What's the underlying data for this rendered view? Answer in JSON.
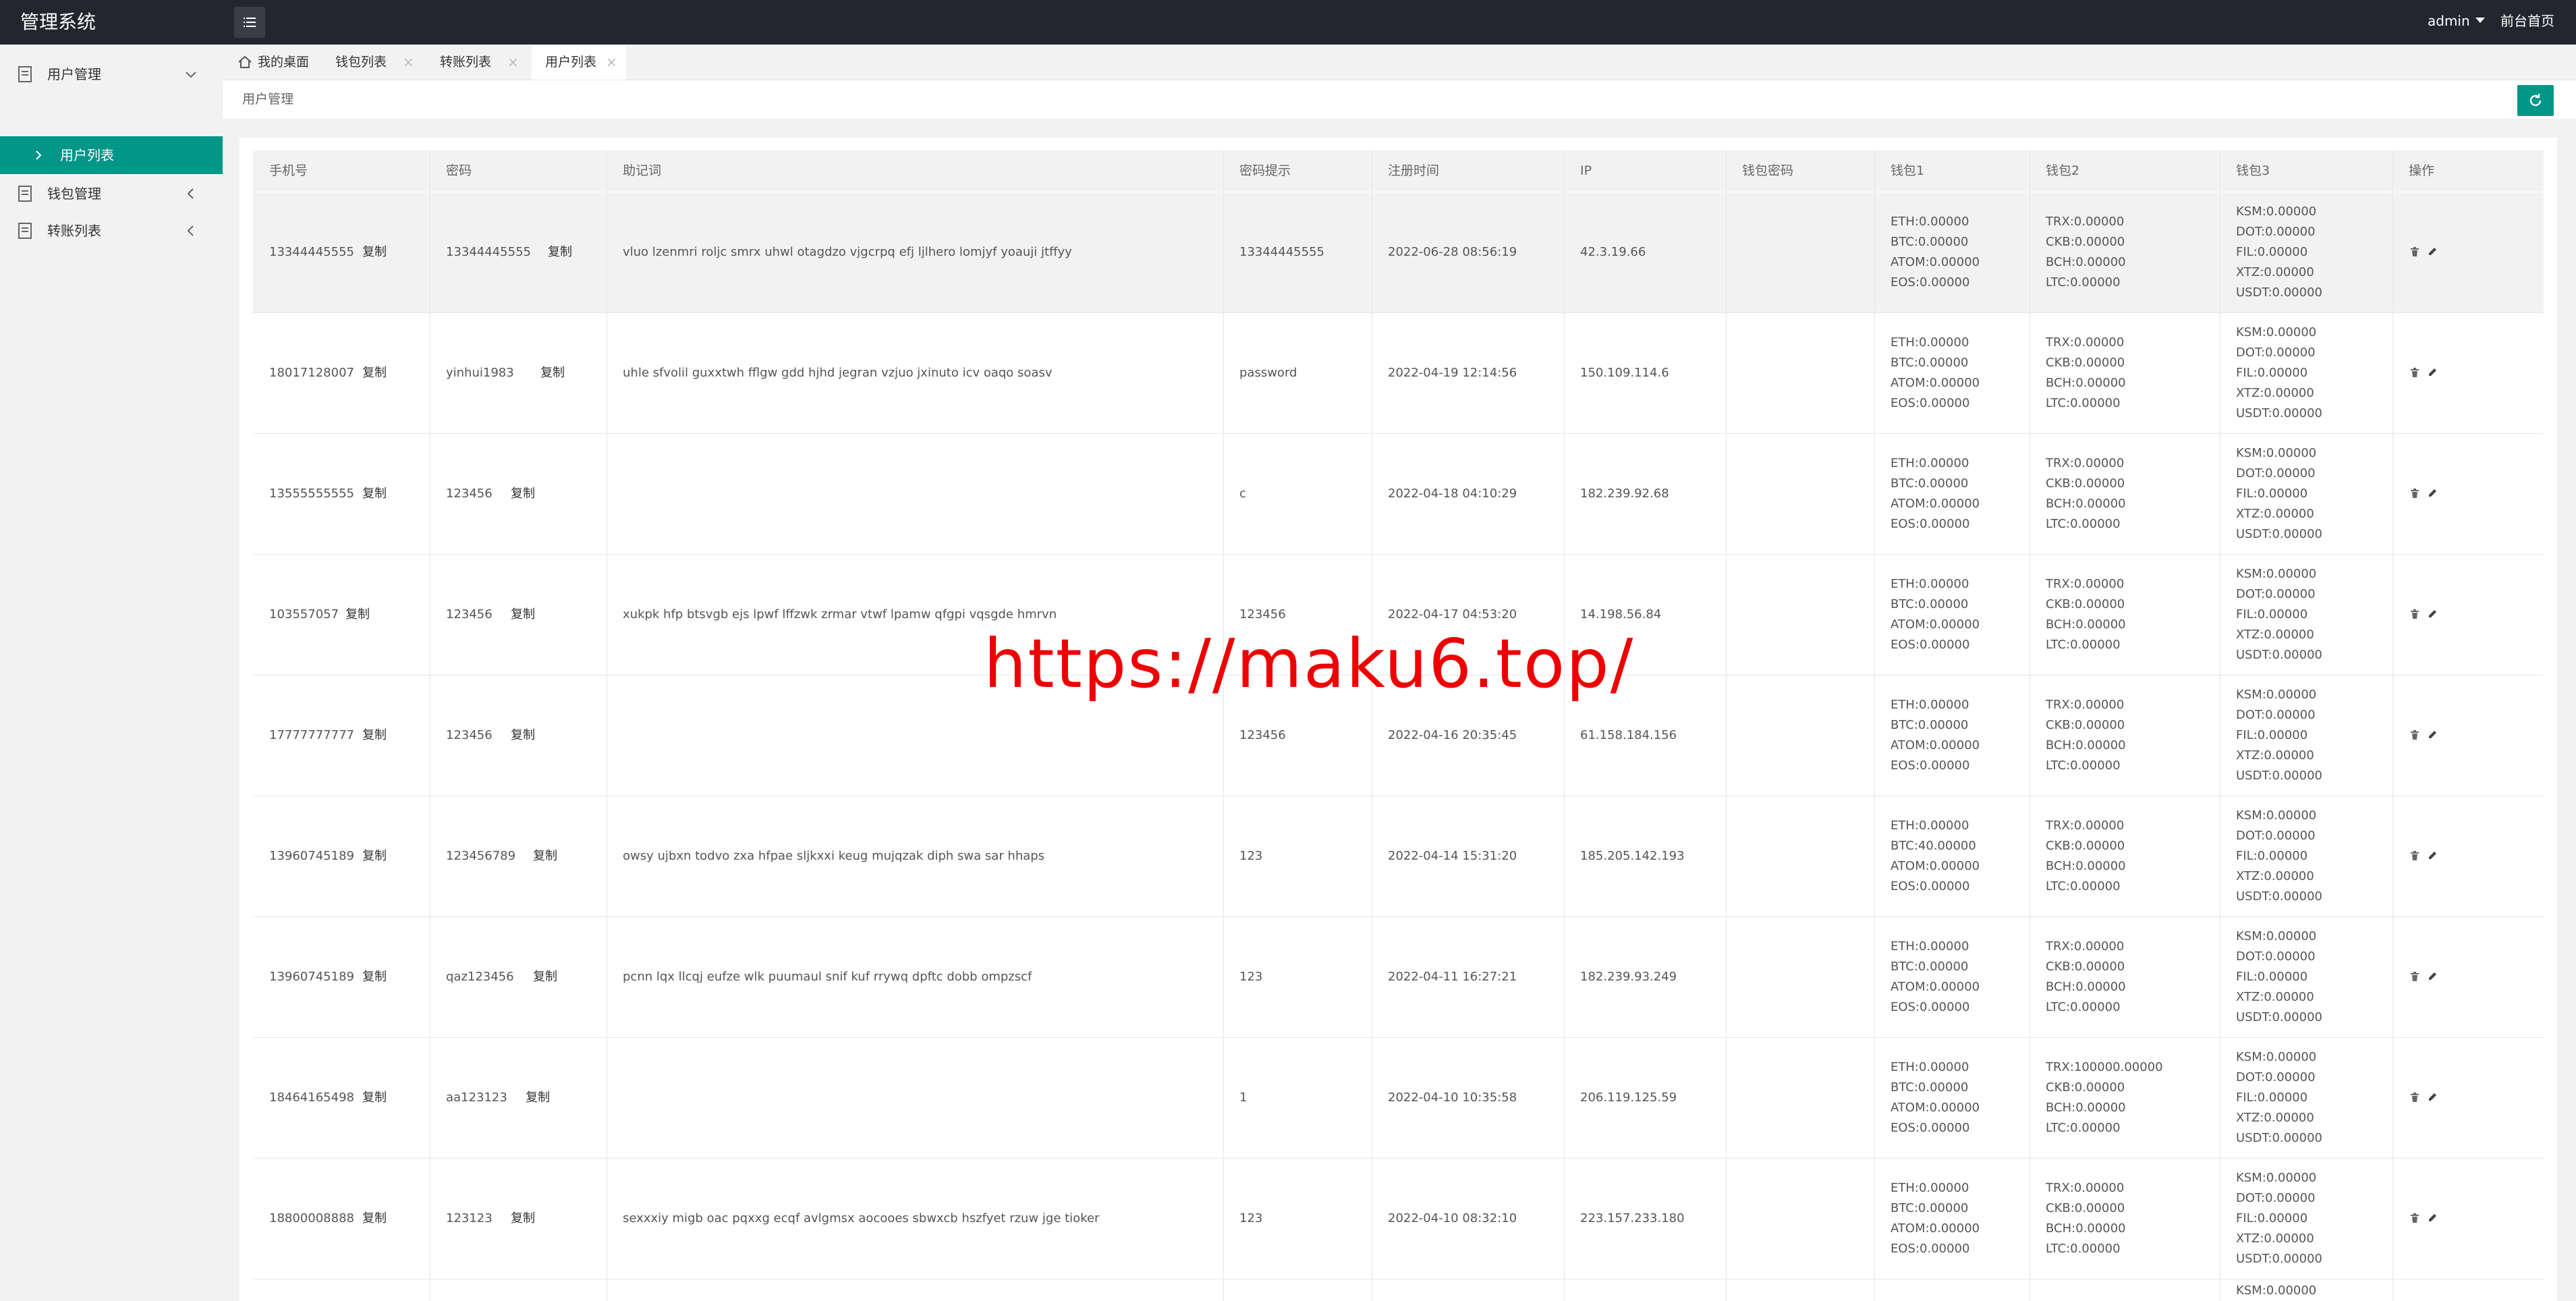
{
  "header": {
    "title": "管理系统",
    "user": "admin",
    "home_link": "前台首页"
  },
  "sidebar": {
    "items": [
      {
        "label": "用户管理"
      },
      {
        "label": "用户列表"
      },
      {
        "label": "钱包管理"
      },
      {
        "label": "转账列表"
      }
    ]
  },
  "tabs": [
    {
      "label": "我的桌面"
    },
    {
      "label": "钱包列表"
    },
    {
      "label": "转账列表"
    },
    {
      "label": "用户列表"
    }
  ],
  "breadcrumb": "用户管理",
  "table": {
    "columns": [
      "手机号",
      "密码",
      "助记词",
      "密码提示",
      "注册时间",
      "IP",
      "钱包密码",
      "钱包1",
      "钱包2",
      "钱包3",
      "操作"
    ],
    "copy_label": "复制",
    "rows": [
      {
        "phone": "13344445555",
        "password": "13344445555",
        "mnemonic": "vluo lzenmri roljc smrx uhwl otagdzo vjgcrpq efj ljlhero lomjyf yoauji jtffyy",
        "hint": "13344445555",
        "time": "2022-06-28 08:56:19",
        "ip": "42.3.19.66",
        "w1": [
          "ETH:0.00000",
          "BTC:0.00000",
          "ATOM:0.00000",
          "EOS:0.00000"
        ],
        "w2": [
          "TRX:0.00000",
          "CKB:0.00000",
          "BCH:0.00000",
          "LTC:0.00000"
        ],
        "w3": [
          "KSM:0.00000",
          "DOT:0.00000",
          "FIL:0.00000",
          "XTZ:0.00000",
          "USDT:0.00000"
        ]
      },
      {
        "phone": "18017128007",
        "password": "yinhui1983",
        "mnemonic": "uhle sfvolil guxxtwh fflgw gdd hjhd jegran vzjuo jxinuto icv oaqo soasv",
        "hint": "password",
        "time": "2022-04-19 12:14:56",
        "ip": "150.109.114.6",
        "w1": [
          "ETH:0.00000",
          "BTC:0.00000",
          "ATOM:0.00000",
          "EOS:0.00000"
        ],
        "w2": [
          "TRX:0.00000",
          "CKB:0.00000",
          "BCH:0.00000",
          "LTC:0.00000"
        ],
        "w3": [
          "KSM:0.00000",
          "DOT:0.00000",
          "FIL:0.00000",
          "XTZ:0.00000",
          "USDT:0.00000"
        ]
      },
      {
        "phone": "13555555555",
        "password": "123456",
        "mnemonic": "",
        "hint": "c",
        "time": "2022-04-18 04:10:29",
        "ip": "182.239.92.68",
        "w1": [
          "ETH:0.00000",
          "BTC:0.00000",
          "ATOM:0.00000",
          "EOS:0.00000"
        ],
        "w2": [
          "TRX:0.00000",
          "CKB:0.00000",
          "BCH:0.00000",
          "LTC:0.00000"
        ],
        "w3": [
          "KSM:0.00000",
          "DOT:0.00000",
          "FIL:0.00000",
          "XTZ:0.00000",
          "USDT:0.00000"
        ]
      },
      {
        "phone": "103557057",
        "password": "123456",
        "mnemonic": "xukpk hfp btsvgb ejs lpwf lffzwk zrmar vtwf lpamw qfgpi vqsgde hmrvn",
        "hint": "123456",
        "time": "2022-04-17 04:53:20",
        "ip": "14.198.56.84",
        "w1": [
          "ETH:0.00000",
          "BTC:0.00000",
          "ATOM:0.00000",
          "EOS:0.00000"
        ],
        "w2": [
          "TRX:0.00000",
          "CKB:0.00000",
          "BCH:0.00000",
          "LTC:0.00000"
        ],
        "w3": [
          "KSM:0.00000",
          "DOT:0.00000",
          "FIL:0.00000",
          "XTZ:0.00000",
          "USDT:0.00000"
        ]
      },
      {
        "phone": "17777777777",
        "password": "123456",
        "mnemonic": "",
        "hint": "123456",
        "time": "2022-04-16 20:35:45",
        "ip": "61.158.184.156",
        "w1": [
          "ETH:0.00000",
          "BTC:0.00000",
          "ATOM:0.00000",
          "EOS:0.00000"
        ],
        "w2": [
          "TRX:0.00000",
          "CKB:0.00000",
          "BCH:0.00000",
          "LTC:0.00000"
        ],
        "w3": [
          "KSM:0.00000",
          "DOT:0.00000",
          "FIL:0.00000",
          "XTZ:0.00000",
          "USDT:0.00000"
        ]
      },
      {
        "phone": "13960745189",
        "password": "123456789",
        "mnemonic": "owsy ujbxn todvo zxa hfpae sljkxxi keug mujqzak diph swa sar hhaps",
        "hint": "123",
        "time": "2022-04-14 15:31:20",
        "ip": "185.205.142.193",
        "w1": [
          "ETH:0.00000",
          "BTC:40.00000",
          "ATOM:0.00000",
          "EOS:0.00000"
        ],
        "w2": [
          "TRX:0.00000",
          "CKB:0.00000",
          "BCH:0.00000",
          "LTC:0.00000"
        ],
        "w3": [
          "KSM:0.00000",
          "DOT:0.00000",
          "FIL:0.00000",
          "XTZ:0.00000",
          "USDT:0.00000"
        ]
      },
      {
        "phone": "13960745189",
        "password": "qaz123456",
        "mnemonic": "pcnn lqx llcqj eufze wlk puumaul snif kuf rrywq dpftc dobb ompzscf",
        "hint": "123",
        "time": "2022-04-11 16:27:21",
        "ip": "182.239.93.249",
        "w1": [
          "ETH:0.00000",
          "BTC:0.00000",
          "ATOM:0.00000",
          "EOS:0.00000"
        ],
        "w2": [
          "TRX:0.00000",
          "CKB:0.00000",
          "BCH:0.00000",
          "LTC:0.00000"
        ],
        "w3": [
          "KSM:0.00000",
          "DOT:0.00000",
          "FIL:0.00000",
          "XTZ:0.00000",
          "USDT:0.00000"
        ]
      },
      {
        "phone": "18464165498",
        "password": "aa123123",
        "mnemonic": "",
        "hint": "1",
        "time": "2022-04-10 10:35:58",
        "ip": "206.119.125.59",
        "w1": [
          "ETH:0.00000",
          "BTC:0.00000",
          "ATOM:0.00000",
          "EOS:0.00000"
        ],
        "w2": [
          "TRX:100000.00000",
          "CKB:0.00000",
          "BCH:0.00000",
          "LTC:0.00000"
        ],
        "w3": [
          "KSM:0.00000",
          "DOT:0.00000",
          "FIL:0.00000",
          "XTZ:0.00000",
          "USDT:0.00000"
        ]
      },
      {
        "phone": "18800008888",
        "password": "123123",
        "mnemonic": "sexxxiy migb oac pqxxg ecqf avlgmsx aocooes sbwxcb hszfyet rzuw jge tioker",
        "hint": "123",
        "time": "2022-04-10 08:32:10",
        "ip": "223.157.233.180",
        "w1": [
          "ETH:0.00000",
          "BTC:0.00000",
          "ATOM:0.00000",
          "EOS:0.00000"
        ],
        "w2": [
          "TRX:0.00000",
          "CKB:0.00000",
          "BCH:0.00000",
          "LTC:0.00000"
        ],
        "w3": [
          "KSM:0.00000",
          "DOT:0.00000",
          "FIL:0.00000",
          "XTZ:0.00000",
          "USDT:0.00000"
        ]
      }
    ],
    "partial_row": {
      "w3_first": "KSM:0.00000"
    }
  },
  "watermark": "https://maku6.top/",
  "colors": {
    "header_bg": "#23262e",
    "accent": "#009688",
    "watermark": "#ef0000"
  }
}
